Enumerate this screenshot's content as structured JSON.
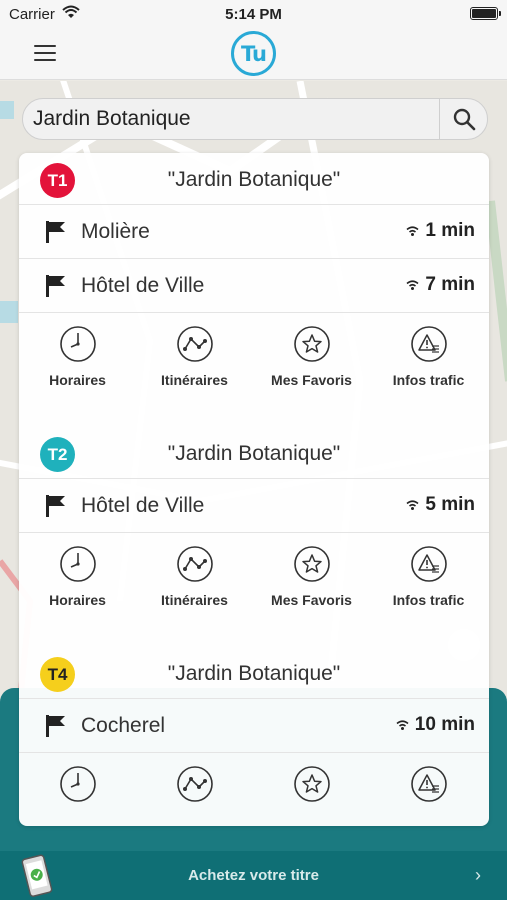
{
  "status_bar": {
    "carrier": "Carrier",
    "time": "5:14 PM"
  },
  "app": {
    "logo_text": "Tu"
  },
  "search": {
    "value": "Jardin Botanique"
  },
  "action_labels": {
    "schedules": "Horaires",
    "routes": "Itinéraires",
    "favorites": "Mes Favoris",
    "traffic": "Infos trafic"
  },
  "lines": [
    {
      "badge": "T1",
      "color": "#e3133a",
      "stop": "\"Jardin Botanique\"",
      "departures": [
        {
          "destination": "Molière",
          "eta": "1 min"
        },
        {
          "destination": "Hôtel de Ville",
          "eta": "7 min"
        }
      ]
    },
    {
      "badge": "T2",
      "color": "#1fb1bc",
      "stop": "\"Jardin Botanique\"",
      "departures": [
        {
          "destination": "Hôtel de Ville",
          "eta": "5 min"
        }
      ]
    },
    {
      "badge": "T4",
      "color": "#f5cf1c",
      "stop": "\"Jardin Botanique\"",
      "departures": [
        {
          "destination": "Cocherel",
          "eta": "10 min"
        }
      ]
    }
  ],
  "banner": {
    "text": "Achetez votre titre"
  }
}
